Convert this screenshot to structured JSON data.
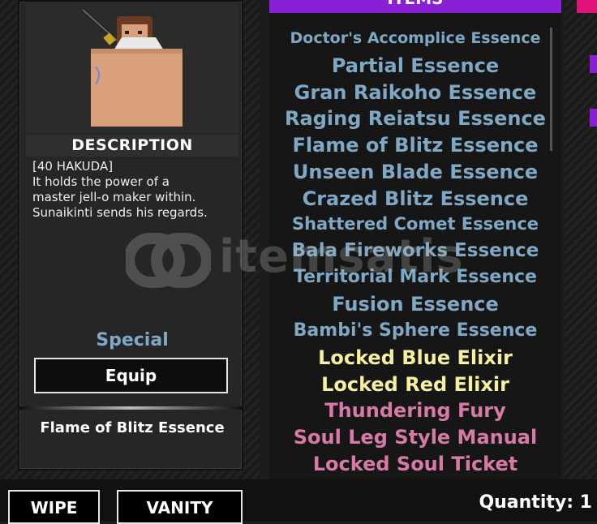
{
  "description": {
    "heading": "DESCRIPTION",
    "lines": [
      "[40 HAKUDA]",
      "It holds the power of a",
      "master jell-o maker within.",
      "Sunaikinti sends his regards."
    ],
    "rarity": "Special",
    "rarity_color": "#7fa8c4",
    "equip_label": "Equip",
    "selected_item": "Flame of Blitz Essence"
  },
  "items_panel": {
    "header": "ITEMS",
    "header_color": "#8a1fd6",
    "items": [
      {
        "name": "Doctor's Accomplice Essence",
        "color": "#7fa8c4"
      },
      {
        "name": "Partial Essence",
        "color": "#7fa8c4"
      },
      {
        "name": "Gran Raikoho Essence",
        "color": "#7fa8c4"
      },
      {
        "name": "Raging Reiatsu Essence",
        "color": "#7fa8c4"
      },
      {
        "name": "Flame of Blitz Essence",
        "color": "#7fa8c4"
      },
      {
        "name": "Unseen Blade Essence",
        "color": "#7fa8c4"
      },
      {
        "name": "Crazed Blitz Essence",
        "color": "#7fa8c4"
      },
      {
        "name": "Shattered Comet Essence",
        "color": "#7fa8c4"
      },
      {
        "name": "Bala Fireworks Essence",
        "color": "#7fa8c4"
      },
      {
        "name": "Territorial Mark Essence",
        "color": "#7fa8c4"
      },
      {
        "name": "Fusion Essence",
        "color": "#7fa8c4"
      },
      {
        "name": "Bambi's Sphere Essence",
        "color": "#7fa8c4"
      },
      {
        "name": "Locked Blue Elixir",
        "color": "#f6f0a0"
      },
      {
        "name": "Locked Red Elixir",
        "color": "#f6f0a0"
      },
      {
        "name": "Thundering Fury",
        "color": "#d77aa8"
      },
      {
        "name": "Soul Leg Style Manual",
        "color": "#d77aa8"
      },
      {
        "name": "Locked Soul Ticket",
        "color": "#d77aa8"
      }
    ]
  },
  "bottom_bar": {
    "wipe_label": "WIPE",
    "vanity_label": "VANITY",
    "quantity_text": "Quantity: 1"
  },
  "watermark": "itemsatis"
}
